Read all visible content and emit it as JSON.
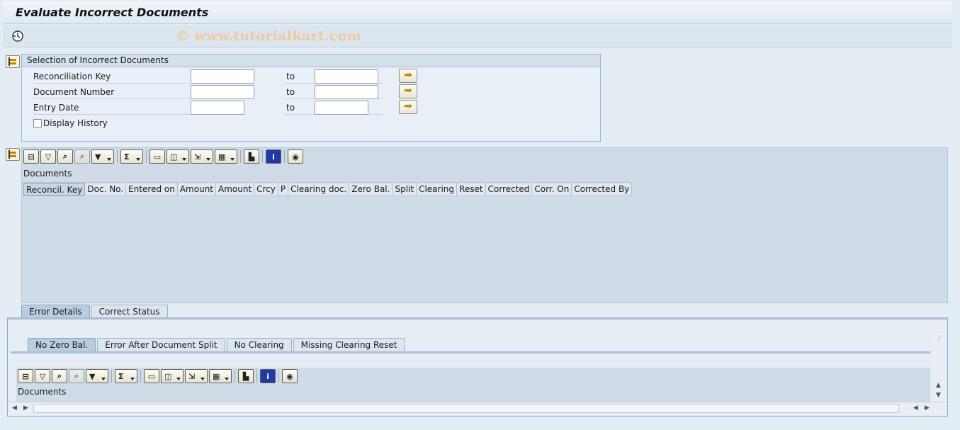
{
  "window": {
    "title": "Evaluate Incorrect Documents"
  },
  "watermark": "© www.tutorialkart.com",
  "selection": {
    "title": "Selection of Incorrect Documents",
    "to_label": "to",
    "rows": [
      {
        "label": "Reconciliation Key",
        "from": "",
        "to": ""
      },
      {
        "label": "Document Number",
        "from": "",
        "to": ""
      },
      {
        "label": "Entry Date",
        "from": "",
        "to": ""
      }
    ],
    "display_history_label": "Display History",
    "display_history_checked": false
  },
  "grid": {
    "title": "Documents",
    "columns": [
      "Reconcil. Key",
      "Doc. No.",
      "Entered on",
      "Amount",
      "Amount",
      "Crcy",
      "P",
      "Clearing doc.",
      "Zero Bal.",
      "Split",
      "Clearing",
      "Reset",
      "Corrected",
      "Corr. On",
      "Corrected By"
    ]
  },
  "outer_tabs": [
    "Error Details",
    "Correct Status"
  ],
  "inner_tabs": [
    "No Zero Bal.",
    "Error After Document Split",
    "No Clearing",
    "Missing Clearing Reset"
  ],
  "inner_grid": {
    "title": "Documents"
  },
  "toolbar_icons": [
    "details-icon",
    "sort-ascending-icon",
    "filter-icon",
    "find-icon",
    "find-next-icon",
    "set-filter-icon",
    "sum-icon",
    "print-icon",
    "views-icon",
    "export-icon",
    "layout-icon",
    "graphic-icon",
    "info-icon",
    "abc-analysis-icon"
  ]
}
